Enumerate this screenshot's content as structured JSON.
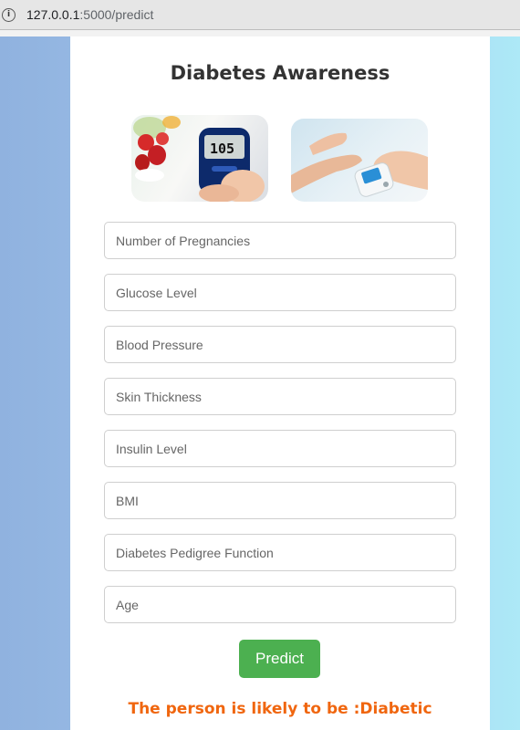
{
  "browser": {
    "url_host": "127.0.0.1",
    "url_rest": ":5000/predict"
  },
  "page": {
    "title": "Diabetes Awareness",
    "images": [
      {
        "icon": "glucose-meter-with-fruit-image",
        "meter_reading": "105"
      },
      {
        "icon": "finger-prick-glucose-test-image"
      }
    ],
    "fields": [
      {
        "placeholder": "Number of Pregnancies",
        "value": ""
      },
      {
        "placeholder": "Glucose Level",
        "value": ""
      },
      {
        "placeholder": "Blood Pressure",
        "value": ""
      },
      {
        "placeholder": "Skin Thickness",
        "value": ""
      },
      {
        "placeholder": "Insulin Level",
        "value": ""
      },
      {
        "placeholder": "BMI",
        "value": ""
      },
      {
        "placeholder": "Diabetes Pedigree Function",
        "value": ""
      },
      {
        "placeholder": "Age",
        "value": ""
      }
    ],
    "predict_label": "Predict",
    "result_text": "The person is likely to be :Diabetic"
  },
  "colors": {
    "accent_button": "#4cb050",
    "result_text": "#f0660f",
    "background_left": "#90b2df",
    "background_right": "#ade9f7"
  }
}
